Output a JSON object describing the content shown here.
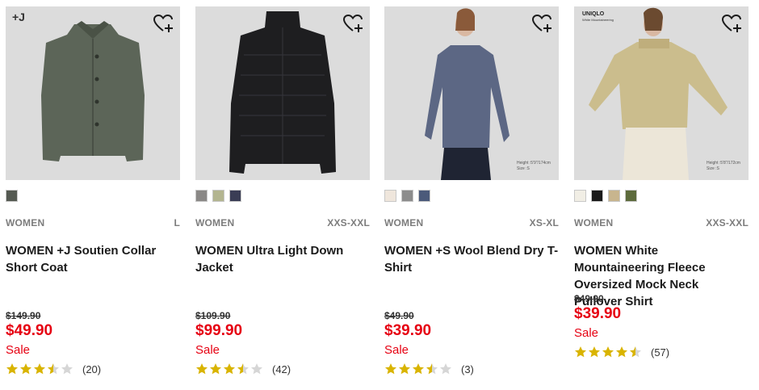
{
  "products": [
    {
      "badge": "+J",
      "favorite_icon": "heart-plus-icon",
      "swatches": [
        "#555a52"
      ],
      "gender": "WOMEN",
      "sizes": "L",
      "name": "WOMEN +J Soutien Collar Short Coat",
      "original_price": "$149.90",
      "price": "$49.90",
      "sale_label": "Sale",
      "rating": 3.5,
      "review_count": "(20)",
      "colors": {
        "garment": "#5c6558",
        "bg": "#dcdcdc"
      }
    },
    {
      "favorite_icon": "heart-plus-icon",
      "swatches": [
        "#8a8886",
        "#b3b590",
        "#3a3d55"
      ],
      "gender": "WOMEN",
      "sizes": "XXS-XXL",
      "name": "WOMEN Ultra Light Down Jacket",
      "original_price": "$109.90",
      "price": "$99.90",
      "sale_label": "Sale",
      "rating": 3.5,
      "review_count": "(42)",
      "colors": {
        "garment": "#1e1e20",
        "bg": "#dcdcdc"
      }
    },
    {
      "favorite_icon": "heart-plus-icon",
      "swatches": [
        "#efe6dc",
        "#8c8c8c",
        "#4b5a7a"
      ],
      "gender": "WOMEN",
      "sizes": "XS-XL",
      "name": "WOMEN +S Wool Blend Dry T-Shirt",
      "original_price": "$49.90",
      "price": "$39.90",
      "sale_label": "Sale",
      "rating": 3.5,
      "review_count": "(3)",
      "height_note": "Height :5'9\"/174cm Size :S",
      "colors": {
        "garment": "#5c6784",
        "bg": "#dcdcdc"
      }
    },
    {
      "logo": "UNIQLO",
      "logo_sub": "White Mountaineering",
      "favorite_icon": "heart-plus-icon",
      "swatches": [
        "#f1eee5",
        "#1a1a1a",
        "#c8b58e",
        "#5d6b3c"
      ],
      "gender": "WOMEN",
      "sizes": "XXS-XXL",
      "name": "WOMEN White Mountaineering Fleece Oversized Mock Neck Pullover Shirt",
      "original_price": "$49.90",
      "price": "$39.90",
      "sale_label": "Sale",
      "rating": 4.5,
      "review_count": "(57)",
      "height_note": "Height :5'8\"/172cm Size :S",
      "colors": {
        "garment": "#cbbd8d",
        "bg": "#dcdcdc"
      }
    }
  ],
  "star_color": "#d9b400",
  "star_empty_color": "#d6d6d6",
  "price_color": "#e60012"
}
